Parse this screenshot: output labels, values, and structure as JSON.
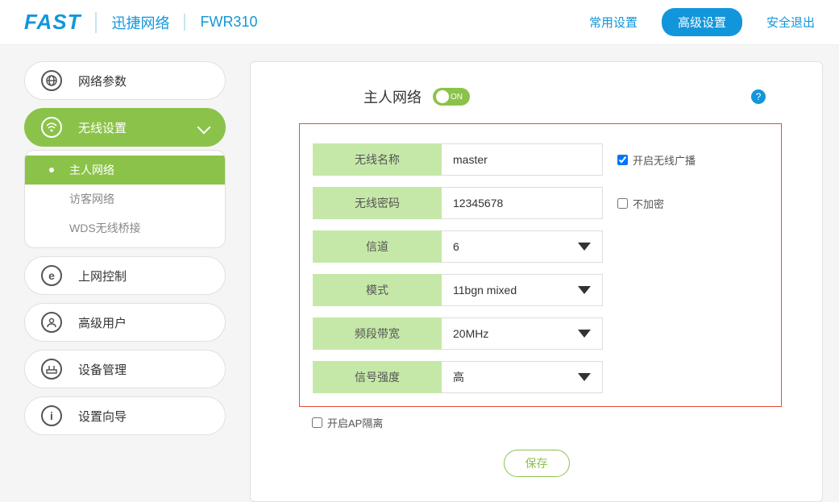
{
  "header": {
    "logo": "FAST",
    "brand": "迅捷网络",
    "model": "FWR310",
    "nav_common": "常用设置",
    "nav_advanced": "高级设置",
    "nav_logout": "安全退出"
  },
  "sidebar": {
    "items": [
      {
        "label": "网络参数",
        "icon": "globe"
      },
      {
        "label": "无线设置",
        "icon": "wifi",
        "active": true
      },
      {
        "label": "上网控制",
        "icon": "e"
      },
      {
        "label": "高级用户",
        "icon": "user"
      },
      {
        "label": "设备管理",
        "icon": "router"
      },
      {
        "label": "设置向导",
        "icon": "info"
      }
    ],
    "submenu": [
      {
        "label": "主人网络",
        "active": true
      },
      {
        "label": "访客网络"
      },
      {
        "label": "WDS无线桥接"
      }
    ]
  },
  "main": {
    "title": "主人网络",
    "toggle_state": "ON",
    "fields": {
      "ssid_label": "无线名称",
      "ssid_value": "master",
      "broadcast_label": "开启无线广播",
      "broadcast_checked": true,
      "password_label": "无线密码",
      "password_value": "12345678",
      "noenc_label": "不加密",
      "noenc_checked": false,
      "channel_label": "信道",
      "channel_value": "6",
      "mode_label": "模式",
      "mode_value": "11bgn mixed",
      "bandwidth_label": "频段带宽",
      "bandwidth_value": "20MHz",
      "signal_label": "信号强度",
      "signal_value": "高"
    },
    "ap_isolate_label": "开启AP隔离",
    "ap_isolate_checked": false,
    "save_label": "保存"
  }
}
